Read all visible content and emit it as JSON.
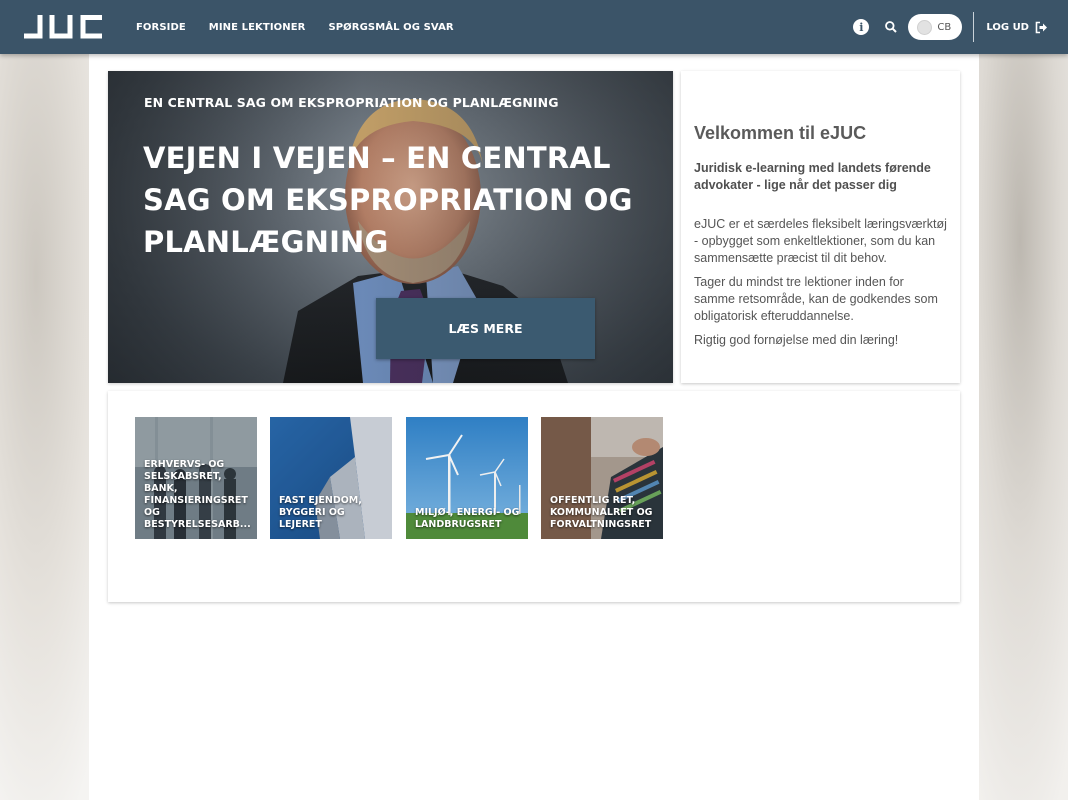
{
  "nav": {
    "items": [
      {
        "label": "FORSIDE"
      },
      {
        "label": "MINE LEKTIONER"
      },
      {
        "label": "SPØRGSMÅL OG SVAR"
      }
    ]
  },
  "header": {
    "info_icon": "info-icon",
    "search_icon": "search-icon",
    "user_initials": "CB",
    "logout_label": "LOG UD",
    "accent_color": "#3b5468"
  },
  "hero": {
    "kicker": "EN CENTRAL SAG OM EKSPROPRIATION OG PLANLÆGNING",
    "title": "VEJEN I VEJEN – EN CENTRAL SAG OM EKSPROPRIATION OG PLANLÆGNING",
    "button_label": "LÆS MERE"
  },
  "welcome": {
    "title": "Velkommen til eJUC",
    "subtitle": "Juridisk e-learning med landets førende advokater - lige når det passer dig",
    "paragraphs": [
      "eJUC er et særdeles fleksibelt læringsværktøj - opbygget som enkeltlektioner, som du kan sammensætte præcist til dit behov.",
      "Tager du mindst tre lektioner inden for samme retsområde, kan de godkendes som obligatorisk efteruddannelse.",
      "Rigtig god fornøjelse med din læring!"
    ]
  },
  "categories": [
    {
      "label": "ERHVERVS- OG SELSKABSRET, BANK, FINANSIERINGSRET OG BESTYRELSESARB..."
    },
    {
      "label": "FAST EJENDOM, BYGGERI OG LEJERET"
    },
    {
      "label": "MILJØ-, ENERGI- OG LANDBRUGSRET"
    },
    {
      "label": "OFFENTLIG RET, KOMMUNALRET OG FORVALTNINGSRET"
    }
  ]
}
